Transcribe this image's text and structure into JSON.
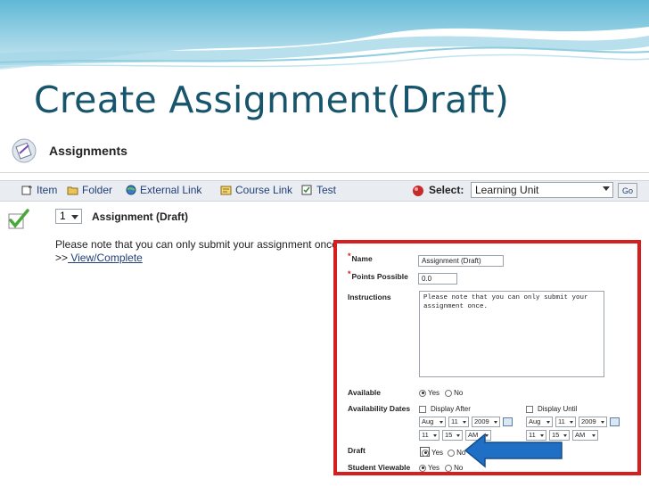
{
  "slide": {
    "title": "Create Assignment(Draft)"
  },
  "screenshot": {
    "header": {
      "title": "Assignments",
      "icon": "assignment-icon"
    },
    "toolbar": {
      "items": [
        {
          "label": "Item",
          "icon": "item-icon"
        },
        {
          "label": "Folder",
          "icon": "folder-icon"
        },
        {
          "label": "External Link",
          "icon": "globe-icon"
        },
        {
          "label": "Course Link",
          "icon": "course-link-icon"
        },
        {
          "label": "Test",
          "icon": "test-icon"
        }
      ],
      "select_label": "Select:",
      "select_value": "Learning Unit",
      "go_label": "Go"
    },
    "item": {
      "order_value": "1",
      "title": "Assignment (Draft)",
      "note": "Please note that you can only submit your assignment once.",
      "link_prefix": ">>",
      "link_label": " View/Complete"
    }
  },
  "form": {
    "name_label": "Name",
    "name_value": "Assignment (Draft)",
    "points_label": "Points Possible",
    "points_value": "0.0",
    "instructions_label": "Instructions",
    "instructions_value": "Please note that you can only submit your assignment once.",
    "available_label": "Available",
    "available_yes": "Yes",
    "available_no": "No",
    "available_selected": "Yes",
    "dates_label": "Availability Dates",
    "display_after_label": "Display After",
    "display_until_label": "Display Until",
    "after": {
      "month": "Aug",
      "day": "11",
      "year": "2009",
      "hour": "11",
      "minute": "15",
      "ampm": "AM"
    },
    "until": {
      "month": "Aug",
      "day": "11",
      "year": "2009",
      "hour": "11",
      "minute": "15",
      "ampm": "AM"
    },
    "draft_label": "Draft",
    "draft_yes": "Yes",
    "draft_no": "No",
    "draft_selected": "Yes",
    "viewable_label": "Student Viewable",
    "viewable_yes": "Yes",
    "viewable_no": "No",
    "viewable_selected": "Yes"
  },
  "colors": {
    "title": "#17556d",
    "highlight_border": "#d71e1e",
    "arrow": "#1f6fc4",
    "link": "#1f3f77"
  }
}
